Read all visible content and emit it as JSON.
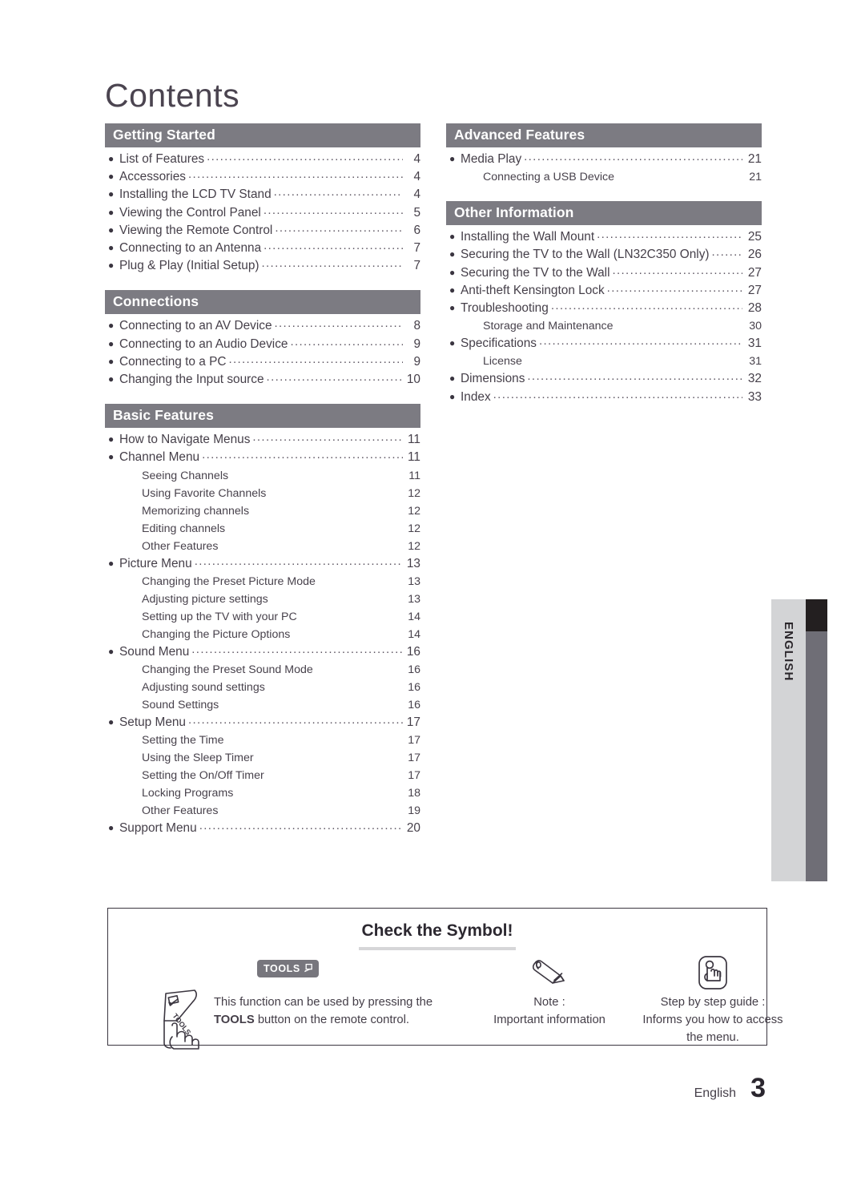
{
  "page": {
    "title": "Contents",
    "footer_label": "English",
    "footer_page": "3",
    "side_tab_label": "ENGLISH",
    "header_bg": "#7c7b82",
    "text_color": "#453f49"
  },
  "columns": {
    "left": [
      {
        "header": "Getting Started",
        "entries": [
          {
            "level": "top",
            "title": "List of Features",
            "page": "4"
          },
          {
            "level": "top",
            "title": "Accessories",
            "page": "4"
          },
          {
            "level": "top",
            "title": "Installing the LCD TV Stand",
            "page": "4"
          },
          {
            "level": "top",
            "title": "Viewing the Control Panel",
            "page": "5"
          },
          {
            "level": "top",
            "title": "Viewing the Remote Control",
            "page": "6"
          },
          {
            "level": "top",
            "title": "Connecting to an Antenna",
            "page": "7"
          },
          {
            "level": "top",
            "title": "Plug & Play (Initial Setup)",
            "page": "7"
          }
        ]
      },
      {
        "header": "Connections",
        "entries": [
          {
            "level": "top",
            "title": "Connecting to an AV Device",
            "page": "8"
          },
          {
            "level": "top",
            "title": "Connecting to an Audio Device",
            "page": "9"
          },
          {
            "level": "top",
            "title": "Connecting to a PC",
            "page": "9"
          },
          {
            "level": "top",
            "title": "Changing the Input source",
            "page": "10"
          }
        ]
      },
      {
        "header": "Basic Features",
        "entries": [
          {
            "level": "top",
            "title": "How to Navigate Menus",
            "page": "11"
          },
          {
            "level": "top",
            "title": "Channel Menu",
            "page": "11"
          },
          {
            "level": "sub",
            "title": "Seeing Channels",
            "page": "11"
          },
          {
            "level": "sub",
            "title": "Using Favorite Channels",
            "page": "12"
          },
          {
            "level": "sub",
            "title": "Memorizing channels",
            "page": "12"
          },
          {
            "level": "sub",
            "title": "Editing channels",
            "page": "12"
          },
          {
            "level": "sub",
            "title": "Other Features",
            "page": "12"
          },
          {
            "level": "top",
            "title": "Picture Menu",
            "page": "13"
          },
          {
            "level": "sub",
            "title": "Changing the Preset Picture Mode",
            "page": "13"
          },
          {
            "level": "sub",
            "title": "Adjusting picture settings",
            "page": "13"
          },
          {
            "level": "sub",
            "title": "Setting up the TV with your PC",
            "page": "14"
          },
          {
            "level": "sub",
            "title": "Changing the Picture Options",
            "page": "14"
          },
          {
            "level": "top",
            "title": "Sound Menu",
            "page": "16"
          },
          {
            "level": "sub",
            "title": "Changing the Preset Sound Mode",
            "page": "16"
          },
          {
            "level": "sub",
            "title": "Adjusting sound settings",
            "page": "16"
          },
          {
            "level": "sub",
            "title": "Sound Settings",
            "page": "16"
          },
          {
            "level": "top",
            "title": "Setup Menu",
            "page": "17"
          },
          {
            "level": "sub",
            "title": "Setting the Time",
            "page": "17"
          },
          {
            "level": "sub",
            "title": "Using the Sleep Timer",
            "page": "17"
          },
          {
            "level": "sub",
            "title": "Setting the On/Off Timer",
            "page": "17"
          },
          {
            "level": "sub",
            "title": "Locking Programs",
            "page": "18"
          },
          {
            "level": "sub",
            "title": "Other Features",
            "page": "19"
          },
          {
            "level": "top",
            "title": "Support Menu",
            "page": "20"
          }
        ]
      }
    ],
    "right": [
      {
        "header": "Advanced Features",
        "entries": [
          {
            "level": "top",
            "title": "Media Play",
            "page": "21"
          },
          {
            "level": "sub",
            "title": "Connecting a USB Device",
            "page": "21"
          }
        ]
      },
      {
        "header": "Other Information",
        "entries": [
          {
            "level": "top",
            "title": "Installing the Wall Mount",
            "page": "25"
          },
          {
            "level": "top",
            "title": "Securing the TV to the Wall (LN32C350 Only)",
            "page": "26"
          },
          {
            "level": "top",
            "title": "Securing the TV to the Wall",
            "page": "27"
          },
          {
            "level": "top",
            "title": "Anti-theft Kensington Lock",
            "page": "27"
          },
          {
            "level": "top",
            "title": "Troubleshooting",
            "page": "28"
          },
          {
            "level": "sub",
            "title": "Storage and Maintenance",
            "page": "30"
          },
          {
            "level": "top",
            "title": "Specifications",
            "page": "31"
          },
          {
            "level": "sub",
            "title": "License",
            "page": "31"
          },
          {
            "level": "top",
            "title": "Dimensions",
            "page": "32"
          },
          {
            "level": "top",
            "title": "Index",
            "page": "33"
          }
        ]
      }
    ]
  },
  "symbol_box": {
    "title": "Check the Symbol!",
    "tools": {
      "badge_label": "TOOLS",
      "line1": "This function can be used by pressing the",
      "line2_bold": "TOOLS",
      "line2_rest": " button on the remote control."
    },
    "note": {
      "label": "Note :",
      "description": "Important information"
    },
    "step_guide": {
      "label": "Step by step guide :",
      "description_line1": "Informs you how to access",
      "description_line2": "the menu."
    }
  }
}
